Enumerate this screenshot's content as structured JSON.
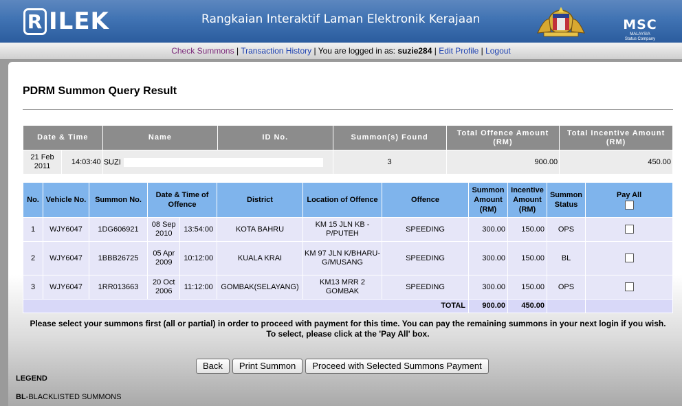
{
  "header": {
    "logo_letter": "R",
    "logo_text": "ILEK",
    "title": "Rangkaian Interaktif Laman Elektronik Kerajaan",
    "msc_text": "MSC",
    "msc_sub": "MALAYSIA",
    "msc_sub2": "Status Company"
  },
  "nav": {
    "check_summons": "Check Summons",
    "transaction_history": "Transaction History",
    "logged_in_as": "You are logged in as:",
    "username": "suzie284",
    "edit_profile": "Edit Profile",
    "logout": "Logout",
    "sep": "|"
  },
  "page_title": "PDRM Summon Query Result",
  "summary": {
    "headers": [
      "Date & Time",
      "Name",
      "ID No.",
      "Summon(s) Found",
      "Total Offence Amount (RM)",
      "Total Incentive Amount (RM)"
    ],
    "date": "21 Feb 2011",
    "time": "14:03:40",
    "name": "SUZI",
    "id_no": "",
    "summons_found": "3",
    "total_offence": "900.00",
    "total_incentive": "450.00"
  },
  "details": {
    "headers": {
      "no": "No.",
      "vehicle": "Vehicle No.",
      "summon_no": "Summon No.",
      "datetime": "Date & Time of Offence",
      "district": "District",
      "location": "Location of Offence",
      "offence": "Offence",
      "summon_amount": "Summon Amount (RM)",
      "incentive_amount": "Incentive Amount (RM)",
      "status": "Summon Status",
      "pay_all": "Pay All"
    },
    "rows": [
      {
        "no": "1",
        "vehicle": "WJY6047",
        "summon_no": "1DG606921",
        "date": "08 Sep 2010",
        "time": "13:54:00",
        "district": "KOTA BAHRU",
        "location": "KM 15 JLN KB - P/PUTEH",
        "offence": "SPEEDING",
        "amount": "300.00",
        "incentive": "150.00",
        "status": "OPS"
      },
      {
        "no": "2",
        "vehicle": "WJY6047",
        "summon_no": "1BBB26725",
        "date": "05 Apr 2009",
        "time": "10:12:00",
        "district": "KUALA KRAI",
        "location": "KM 97 JLN K/BHARU-G/MUSANG",
        "offence": "SPEEDING",
        "amount": "300.00",
        "incentive": "150.00",
        "status": "BL"
      },
      {
        "no": "3",
        "vehicle": "WJY6047",
        "summon_no": "1RR013663",
        "date": "20 Oct 2006",
        "time": "11:12:00",
        "district": "GOMBAK(SELAYANG)",
        "location": "KM13 MRR 2 GOMBAK",
        "offence": "SPEEDING",
        "amount": "300.00",
        "incentive": "150.00",
        "status": "OPS"
      }
    ],
    "total_label": "TOTAL",
    "total_amount": "900.00",
    "total_incentive": "450.00"
  },
  "note": "Please select your summons first (all or partial) in order to proceed with payment for this time. You can pay the remaining summons in your next login if you wish. To select, please click at the 'Pay All' box.",
  "buttons": {
    "back": "Back",
    "print": "Print Summon",
    "proceed": "Proceed with Selected Summons Payment"
  },
  "legend": {
    "title": "LEGEND",
    "bl_code": "BL",
    "bl_text": "-BLACKLISTED SUMMONS"
  },
  "colors": {
    "header_blue": "#2b5c9e",
    "table_header_blue": "#7fb4ec",
    "summary_header_gray": "#8c8c8c",
    "row_bg": "#e6e6f8"
  }
}
